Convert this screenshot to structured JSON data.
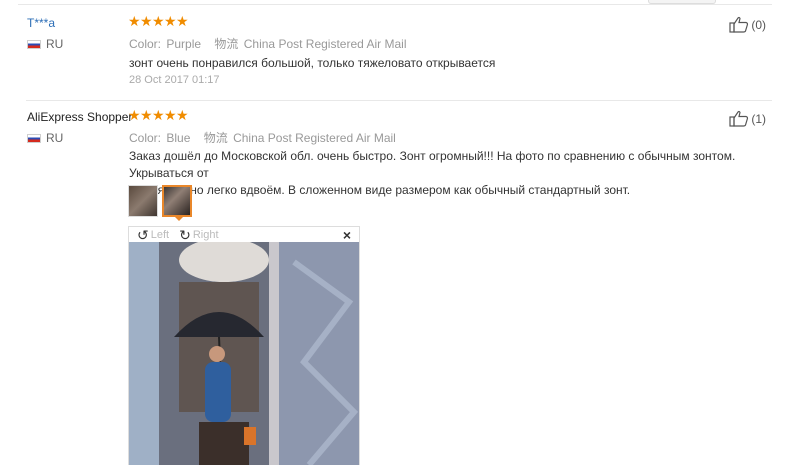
{
  "reviews": [
    {
      "user": "T***a",
      "country": "RU",
      "color_label": "Color:",
      "color_value": "Purple",
      "shipping_label": "物流",
      "shipping_value": "China Post Registered Air Mail",
      "text": "зонт очень понравился большой, только тяжеловато открывается",
      "date": "28 Oct 2017 01:17",
      "helpful_count": "(0)",
      "stars": 5
    },
    {
      "user": "AliExpress Shopper",
      "country": "RU",
      "color_label": "Color:",
      "color_value": "Blue",
      "shipping_label": "物流",
      "shipping_value": "China Post Registered Air Mail",
      "text_line1": "Заказ дошёл до Московской обл. очень быстро. Зонт огромный!!! На фото по сравнению с обычным зонтом. Укрываться от",
      "text_line2": "дождя можно легко вдвоём. В сложенном виде размером как обычный стандартный зонт.",
      "helpful_count": "(1)",
      "stars": 5
    }
  ],
  "viewer": {
    "rotate_left_label": "Left",
    "rotate_right_label": "Right",
    "close_label": "×"
  },
  "icons": {
    "star": "★",
    "thumbs_up": "thumbs-up-icon",
    "rotate_left": "↺",
    "rotate_right": "↻"
  },
  "colors": {
    "star": "#f08c00",
    "link": "#2e6fb7",
    "selected_border": "#e9872a"
  }
}
